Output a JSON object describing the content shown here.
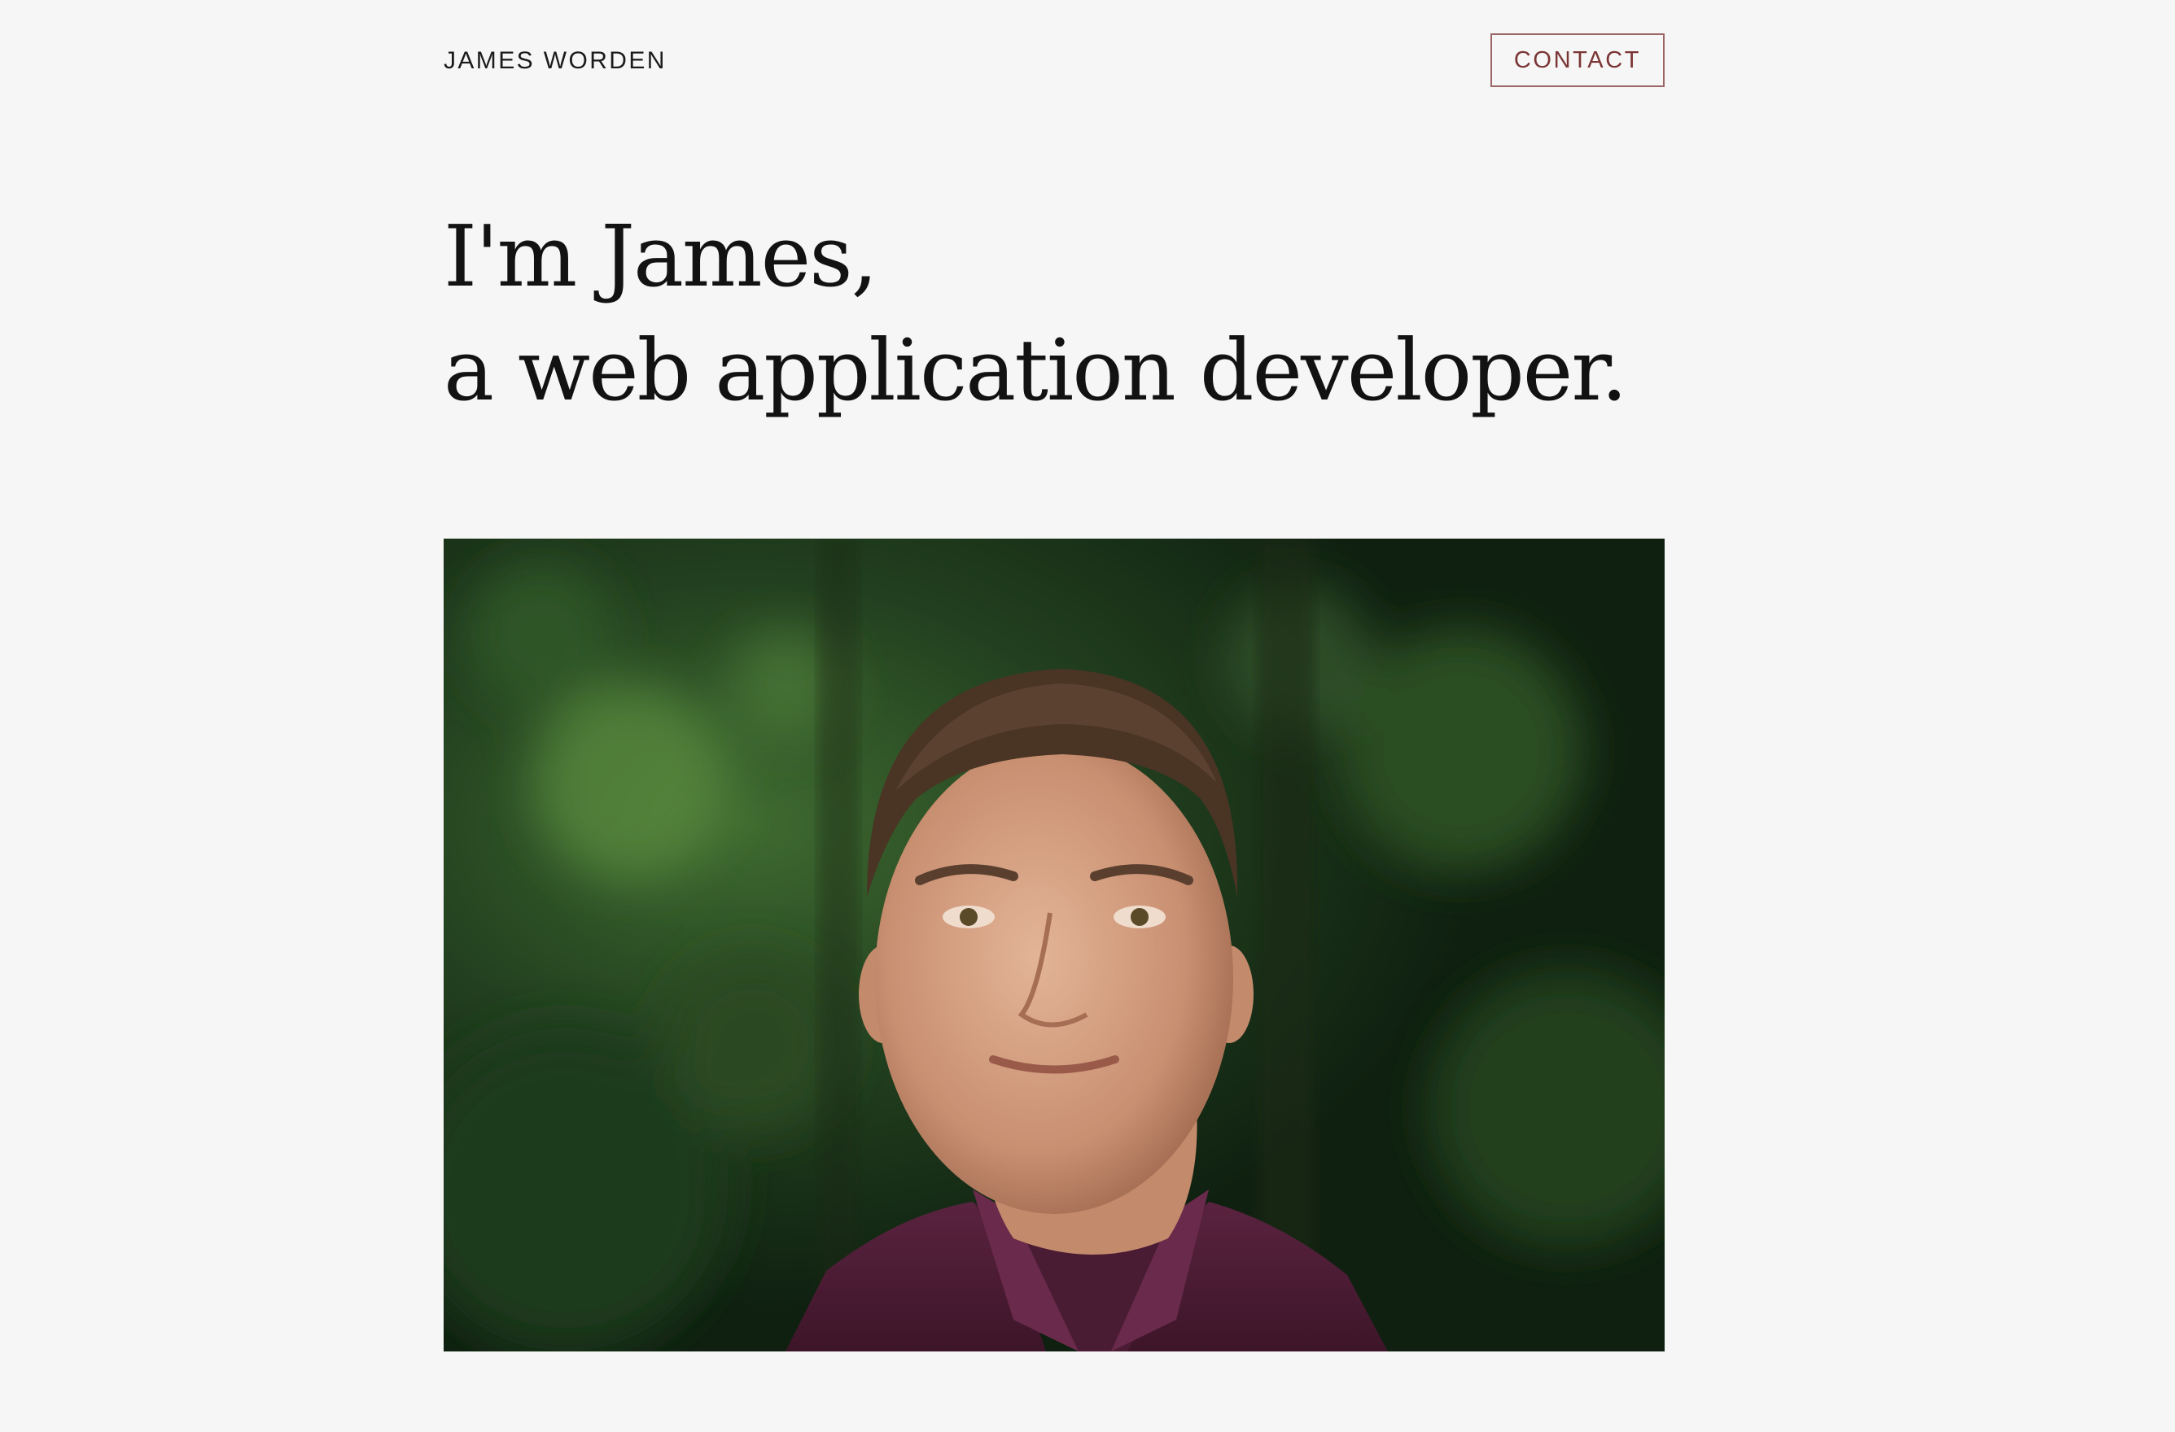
{
  "header": {
    "site_name": "JAMES WORDEN",
    "contact_label": "CONTACT"
  },
  "hero": {
    "line1": "I'm James,",
    "line2": "a web application developer."
  },
  "portrait": {
    "subject": "portrait photo of James"
  },
  "colors": {
    "background": "#f6f6f6",
    "accent": "#7b3535",
    "accent_border": "#9c6566",
    "text": "#121212"
  }
}
